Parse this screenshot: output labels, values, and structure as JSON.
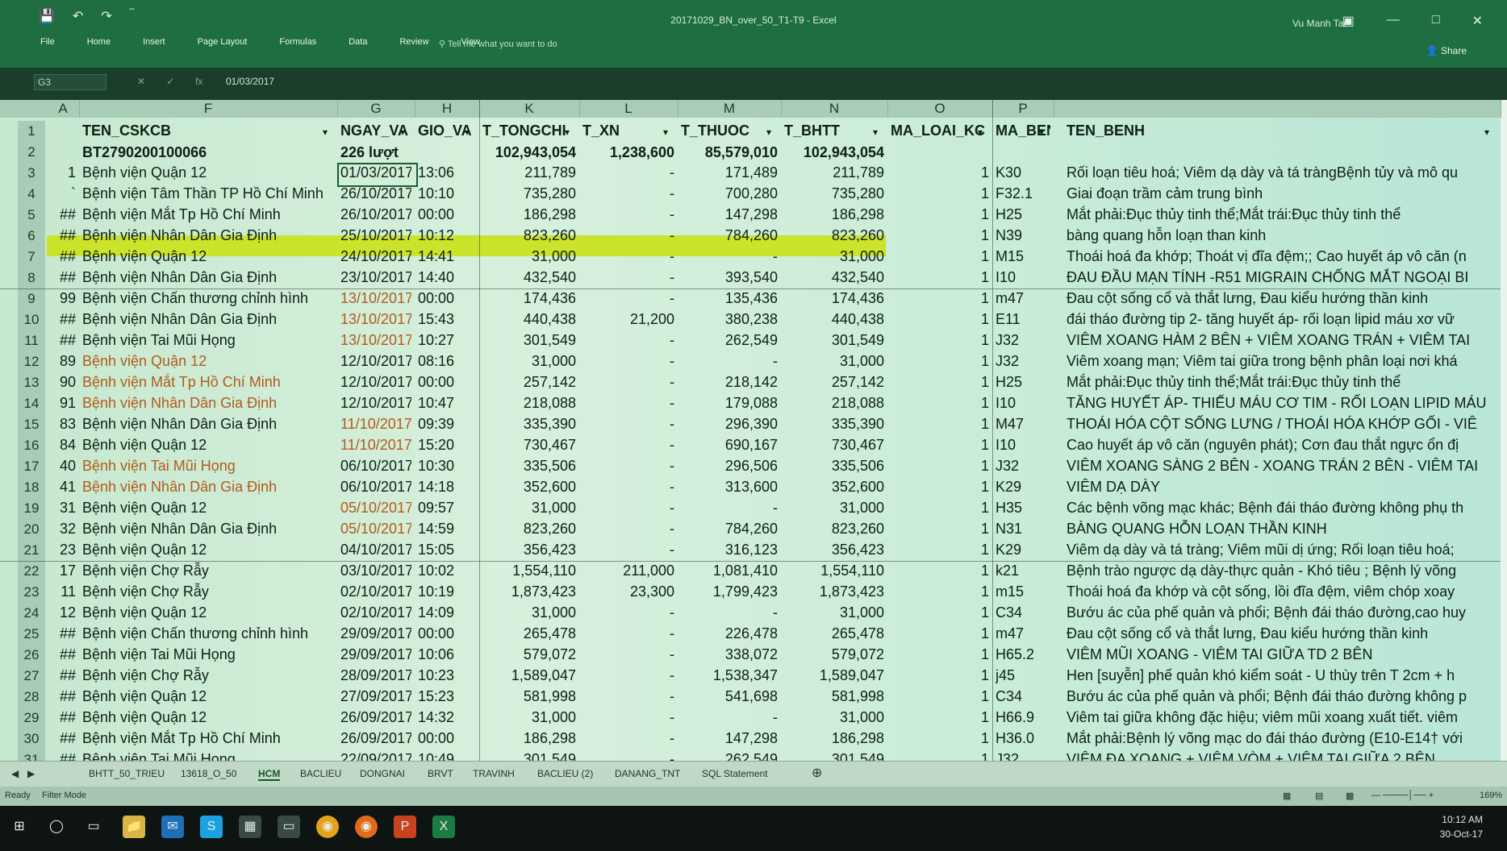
{
  "app": {
    "title": "20171029_BN_over_50_T1-T9  -  Excel",
    "user": "Vu Manh Tai",
    "share": "Share",
    "ribbon_tabs": [
      "File",
      "Home",
      "Insert",
      "Page Layout",
      "Formulas",
      "Data",
      "Review",
      "View"
    ],
    "tell_me": "Tell me what you want to do"
  },
  "formula_bar": {
    "name_box": "G3",
    "value": "01/03/2017"
  },
  "columns": [
    "A",
    "F",
    "G",
    "H",
    "K",
    "L",
    "M",
    "N",
    "O",
    "P"
  ],
  "header_row": [
    "TEN_CSKCB",
    "NGAY_VA",
    "GIO_VA",
    "T_TONGCHI",
    "T_XN",
    "T_THUOC",
    "T_BHTT",
    "MA_LOAI_KC",
    "MA_BEN",
    "TEN_BENH"
  ],
  "summary_row": {
    "code": "BT2790200100066",
    "count": "226 lượt",
    "tongchi": "102,943,054",
    "xn": "1,238,600",
    "thuoc": "85,579,010",
    "bhtt": "102,943,054"
  },
  "rows": [
    {
      "n": "3",
      "a": "1",
      "f": "Bệnh viện Quận 12",
      "g": "01/03/2017",
      "h": "13:06",
      "k": "211,789",
      "l": "-",
      "m": "171,489",
      "nn": "211,789",
      "o": "1",
      "p": "K30",
      "q": "Rối loạn tiêu hoá; Viêm dạ dày và tá tràngBệnh tủy và mô qu",
      "fo": false,
      "go": false
    },
    {
      "n": "4",
      "a": "`",
      "f": "Bệnh viện Tâm Thần TP Hồ Chí Minh",
      "g": "26/10/2017",
      "h": "10:10",
      "k": "735,280",
      "l": "-",
      "m": "700,280",
      "nn": "735,280",
      "o": "1",
      "p": "F32.1",
      "q": "Giai đoạn trầm cảm trung bình",
      "fo": false,
      "go": false
    },
    {
      "n": "5",
      "a": "##",
      "f": "Bệnh viện Mắt Tp Hồ Chí Minh",
      "g": "26/10/2017",
      "h": "00:00",
      "k": "186,298",
      "l": "-",
      "m": "147,298",
      "nn": "186,298",
      "o": "1",
      "p": "H25",
      "q": "Mắt phải:Đục thủy tinh thể;Mắt trái:Đục thủy tinh thể",
      "fo": false,
      "go": false
    },
    {
      "n": "6",
      "a": "##",
      "f": "Bệnh viện Nhân Dân Gia Định",
      "g": "25/10/2017",
      "h": "10:12",
      "k": "823,260",
      "l": "-",
      "m": "784,260",
      "nn": "823,260",
      "o": "1",
      "p": "N39",
      "q": "bàng quang hỗn loạn than kinh",
      "fo": false,
      "go": false
    },
    {
      "n": "7",
      "a": "##",
      "f": "Bệnh viện Quận 12",
      "g": "24/10/2017",
      "h": "14:41",
      "k": "31,000",
      "l": "-",
      "m": "-",
      "nn": "31,000",
      "o": "1",
      "p": "M15",
      "q": "Thoái hoá đa khớp; Thoát vị đĩa đệm;; Cao huyết áp vô căn (n",
      "fo": false,
      "go": false
    },
    {
      "n": "8",
      "a": "##",
      "f": "Bệnh viện Nhân Dân Gia Định",
      "g": "23/10/2017",
      "h": "14:40",
      "k": "432,540",
      "l": "-",
      "m": "393,540",
      "nn": "432,540",
      "o": "1",
      "p": "I10",
      "q": "ĐAU ĐẦU MẠN TÍNH -R51 MIGRAIN CHỐNG MẮT NGOẠI BI",
      "fo": false,
      "go": false
    },
    {
      "n": "9",
      "a": "99",
      "f": "Bệnh viện Chấn thương chỉnh hình",
      "g": "13/10/2017",
      "h": "00:00",
      "k": "174,436",
      "l": "-",
      "m": "135,436",
      "nn": "174,436",
      "o": "1",
      "p": "m47",
      "q": "Đau cột sống cổ và thắt lưng, Đau kiểu hướng thần kinh",
      "fo": false,
      "go": true
    },
    {
      "n": "10",
      "a": "##",
      "f": "Bệnh viện Nhân Dân Gia Định",
      "g": "13/10/2017",
      "h": "15:43",
      "k": "440,438",
      "l": "21,200",
      "m": "380,238",
      "nn": "440,438",
      "o": "1",
      "p": "E11",
      "q": "đái tháo đường tip 2- tăng huyết áp- rối loạn lipid máu xơ vữ",
      "fo": false,
      "go": true
    },
    {
      "n": "11",
      "a": "##",
      "f": "Bệnh viện Tai Mũi Họng",
      "g": "13/10/2017",
      "h": "10:27",
      "k": "301,549",
      "l": "-",
      "m": "262,549",
      "nn": "301,549",
      "o": "1",
      "p": "J32",
      "q": "VIÊM XOANG HÀM 2 BÊN + VIÊM XOANG TRÁN + VIÊM TAI",
      "fo": false,
      "go": true
    },
    {
      "n": "12",
      "a": "89",
      "f": "Bệnh viện Quận 12",
      "g": "12/10/2017",
      "h": "08:16",
      "k": "31,000",
      "l": "-",
      "m": "-",
      "nn": "31,000",
      "o": "1",
      "p": "J32",
      "q": "Viêm xoang mạn; Viêm tai giữa trong bệnh phân loại nơi khá",
      "fo": true,
      "go": false
    },
    {
      "n": "13",
      "a": "90",
      "f": "Bệnh viện Mắt Tp Hồ Chí Minh",
      "g": "12/10/2017",
      "h": "00:00",
      "k": "257,142",
      "l": "-",
      "m": "218,142",
      "nn": "257,142",
      "o": "1",
      "p": "H25",
      "q": "Mắt phải:Đục thủy tinh thể;Mắt trái:Đục thủy tinh thể",
      "fo": true,
      "go": false
    },
    {
      "n": "14",
      "a": "91",
      "f": "Bệnh viện Nhân Dân Gia Định",
      "g": "12/10/2017",
      "h": "10:47",
      "k": "218,088",
      "l": "-",
      "m": "179,088",
      "nn": "218,088",
      "o": "1",
      "p": "I10",
      "q": "TĂNG HUYẾT ÁP- THIẾU MÁU CƠ TIM - RỐI LOẠN LIPID MÁU",
      "fo": true,
      "go": false
    },
    {
      "n": "15",
      "a": "83",
      "f": "Bệnh viện Nhân Dân Gia Định",
      "g": "11/10/2017",
      "h": "09:39",
      "k": "335,390",
      "l": "-",
      "m": "296,390",
      "nn": "335,390",
      "o": "1",
      "p": "M47",
      "q": "THOÁI HÓA CỘT SỐNG LƯNG / THOÁI HÓA KHỚP GỐI - VIÊ",
      "fo": false,
      "go": true
    },
    {
      "n": "16",
      "a": "84",
      "f": "Bệnh viện Quận 12",
      "g": "11/10/2017",
      "h": "15:20",
      "k": "730,467",
      "l": "-",
      "m": "690,167",
      "nn": "730,467",
      "o": "1",
      "p": "I10",
      "q": "Cao huyết áp vô căn (nguyên phát); Cơn đau thắt ngực ổn đị",
      "fo": false,
      "go": true
    },
    {
      "n": "17",
      "a": "40",
      "f": "Bệnh viện Tai Mũi Họng",
      "g": "06/10/2017",
      "h": "10:30",
      "k": "335,506",
      "l": "-",
      "m": "296,506",
      "nn": "335,506",
      "o": "1",
      "p": "J32",
      "q": "VIÊM XOANG SÀNG 2 BÊN - XOANG TRÁN 2 BÊN - VIÊM TAI",
      "fo": true,
      "go": false
    },
    {
      "n": "18",
      "a": "41",
      "f": "Bệnh viện Nhân Dân Gia Định",
      "g": "06/10/2017",
      "h": "14:18",
      "k": "352,600",
      "l": "-",
      "m": "313,600",
      "nn": "352,600",
      "o": "1",
      "p": "K29",
      "q": "VIÊM DẠ DÀY",
      "fo": true,
      "go": false
    },
    {
      "n": "19",
      "a": "31",
      "f": "Bệnh viện Quận 12",
      "g": "05/10/2017",
      "h": "09:57",
      "k": "31,000",
      "l": "-",
      "m": "-",
      "nn": "31,000",
      "o": "1",
      "p": "H35",
      "q": "Các bệnh võng mạc khác; Bệnh đái tháo đường không phụ th",
      "fo": false,
      "go": true
    },
    {
      "n": "20",
      "a": "32",
      "f": "Bệnh viện Nhân Dân Gia Định",
      "g": "05/10/2017",
      "h": "14:59",
      "k": "823,260",
      "l": "-",
      "m": "784,260",
      "nn": "823,260",
      "o": "1",
      "p": "N31",
      "q": "BÀNG QUANG HỖN LOẠN THẦN KINH",
      "fo": false,
      "go": true
    },
    {
      "n": "21",
      "a": "23",
      "f": "Bệnh viện Quận 12",
      "g": "04/10/2017",
      "h": "15:05",
      "k": "356,423",
      "l": "-",
      "m": "316,123",
      "nn": "356,423",
      "o": "1",
      "p": "K29",
      "q": "Viêm dạ dày và tá tràng; Viêm mũi dị ứng; Rối loạn tiêu hoá;",
      "fo": false,
      "go": false
    },
    {
      "n": "22",
      "a": "17",
      "f": "Bệnh viện Chợ Rẫy",
      "g": "03/10/2017",
      "h": "10:02",
      "k": "1,554,110",
      "l": "211,000",
      "m": "1,081,410",
      "nn": "1,554,110",
      "o": "1",
      "p": "k21",
      "q": "Bệnh trào ngược dạ dày-thực quản - Khó tiêu ; Bệnh lý võng",
      "fo": false,
      "go": false
    },
    {
      "n": "23",
      "a": "11",
      "f": "Bệnh viện Chợ Rẫy",
      "g": "02/10/2017",
      "h": "10:19",
      "k": "1,873,423",
      "l": "23,300",
      "m": "1,799,423",
      "nn": "1,873,423",
      "o": "1",
      "p": "m15",
      "q": "Thoái hoá đa khớp  và cột sống, lồi đĩa đệm, viêm chóp xoay",
      "fo": false,
      "go": false
    },
    {
      "n": "24",
      "a": "12",
      "f": "Bệnh viện Quận 12",
      "g": "02/10/2017",
      "h": "14:09",
      "k": "31,000",
      "l": "-",
      "m": "-",
      "nn": "31,000",
      "o": "1",
      "p": "C34",
      "q": "Bướu ác của phế quản và phổi; Bệnh đái tháo đường,cao huy",
      "fo": false,
      "go": false
    },
    {
      "n": "25",
      "a": "##",
      "f": "Bệnh viện Chấn thương chỉnh hình",
      "g": "29/09/2017",
      "h": "00:00",
      "k": "265,478",
      "l": "-",
      "m": "226,478",
      "nn": "265,478",
      "o": "1",
      "p": "m47",
      "q": "Đau cột sống cổ và thắt lưng, Đau kiểu hướng thần kinh",
      "fo": false,
      "go": false
    },
    {
      "n": "26",
      "a": "##",
      "f": "Bệnh viện Tai Mũi Họng",
      "g": "29/09/2017",
      "h": "10:06",
      "k": "579,072",
      "l": "-",
      "m": "338,072",
      "nn": "579,072",
      "o": "1",
      "p": "H65.2",
      "q": "VIÊM MŨI XOANG - VIÊM TAI GIỮA TD 2 BÊN",
      "fo": false,
      "go": false
    },
    {
      "n": "27",
      "a": "##",
      "f": "Bệnh viện Chợ Rẫy",
      "g": "28/09/2017",
      "h": "10:23",
      "k": "1,589,047",
      "l": "-",
      "m": "1,538,347",
      "nn": "1,589,047",
      "o": "1",
      "p": "j45",
      "q": "Hen [suyễn] phế quản khó kiểm soát  - U thùy trên T 2cm + h",
      "fo": false,
      "go": false
    },
    {
      "n": "28",
      "a": "##",
      "f": "Bệnh viện Quận 12",
      "g": "27/09/2017",
      "h": "15:23",
      "k": "581,998",
      "l": "-",
      "m": "541,698",
      "nn": "581,998",
      "o": "1",
      "p": "C34",
      "q": "Bướu ác của phế quản và phổi; Bệnh đái tháo đường không p",
      "fo": false,
      "go": false
    },
    {
      "n": "29",
      "a": "##",
      "f": "Bệnh viện Quận 12",
      "g": "26/09/2017",
      "h": "14:32",
      "k": "31,000",
      "l": "-",
      "m": "-",
      "nn": "31,000",
      "o": "1",
      "p": "H66.9",
      "q": "Viêm tai giữa không đặc hiệu; viêm mũi xoang xuất tiết. viêm",
      "fo": false,
      "go": false
    },
    {
      "n": "30",
      "a": "##",
      "f": "Bệnh viện Mắt Tp Hồ Chí Minh",
      "g": "26/09/2017",
      "h": "00:00",
      "k": "186,298",
      "l": "-",
      "m": "147,298",
      "nn": "186,298",
      "o": "1",
      "p": "H36.0",
      "q": "Mắt phải:Bệnh lý võng mạc do đái tháo đường (E10-E14† với",
      "fo": false,
      "go": false
    },
    {
      "n": "31",
      "a": "##",
      "f": "Bệnh viện Tai Mũi Họng",
      "g": "22/09/2017",
      "h": "10:49",
      "k": "301,549",
      "l": "-",
      "m": "262,549",
      "nn": "301,549",
      "o": "1",
      "p": "J32",
      "q": "VIÊM ĐA XOANG + VIÊM VÒM + VIÊM TAI GIỮA 2 BÊN",
      "fo": false,
      "go": false
    }
  ],
  "sheet_tabs": [
    "BHTT_50_TRIEU",
    "13618_O_50",
    "HCM",
    "BACLIEU",
    "DONGNAI",
    "BRVT",
    "TRAVINH",
    "BACLIEU (2)",
    "DANANG_TNT",
    "SQL Statement"
  ],
  "active_tab": "HCM",
  "status": {
    "ready": "Ready",
    "mode": "Filter Mode",
    "zoom": "169%"
  },
  "clock": {
    "time": "10:12 AM",
    "date": "30-Oct-17"
  }
}
